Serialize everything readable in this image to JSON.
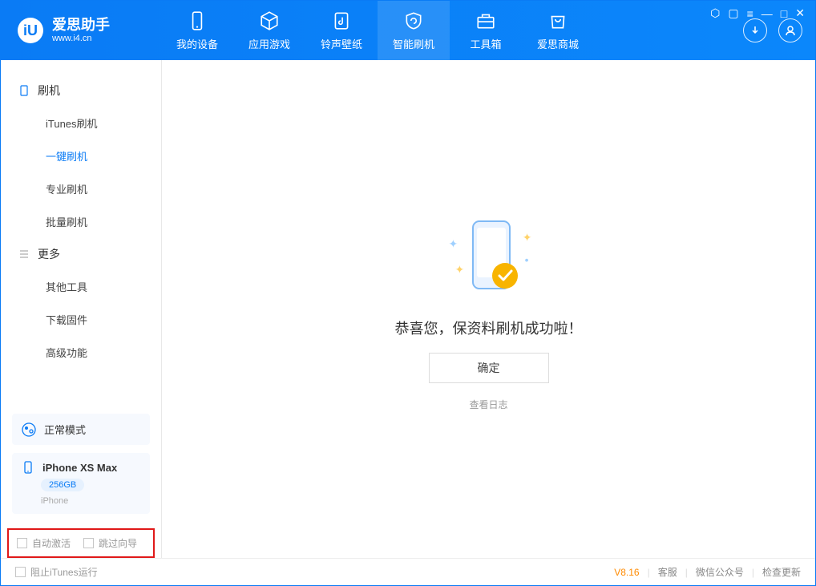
{
  "app": {
    "title": "爱思助手",
    "url": "www.i4.cn"
  },
  "tabs": [
    {
      "label": "我的设备",
      "icon": "device"
    },
    {
      "label": "应用游戏",
      "icon": "cube"
    },
    {
      "label": "铃声壁纸",
      "icon": "music"
    },
    {
      "label": "智能刷机",
      "icon": "refresh",
      "active": true
    },
    {
      "label": "工具箱",
      "icon": "toolbox"
    },
    {
      "label": "爱思商城",
      "icon": "store"
    }
  ],
  "sidebar": {
    "group1": {
      "title": "刷机",
      "items": [
        "iTunes刷机",
        "一键刷机",
        "专业刷机",
        "批量刷机"
      ],
      "activeIndex": 1
    },
    "group2": {
      "title": "更多",
      "items": [
        "其他工具",
        "下载固件",
        "高级功能"
      ]
    }
  },
  "mode": {
    "label": "正常模式"
  },
  "device": {
    "name": "iPhone XS Max",
    "capacity": "256GB",
    "type": "iPhone"
  },
  "options": {
    "autoActivate": "自动激活",
    "skipGuide": "跳过向导"
  },
  "main": {
    "successMsg": "恭喜您，保资料刷机成功啦！",
    "okBtn": "确定",
    "logLink": "查看日志"
  },
  "status": {
    "blockItunes": "阻止iTunes运行",
    "version": "V8.16",
    "links": [
      "客服",
      "微信公众号",
      "检查更新"
    ]
  }
}
